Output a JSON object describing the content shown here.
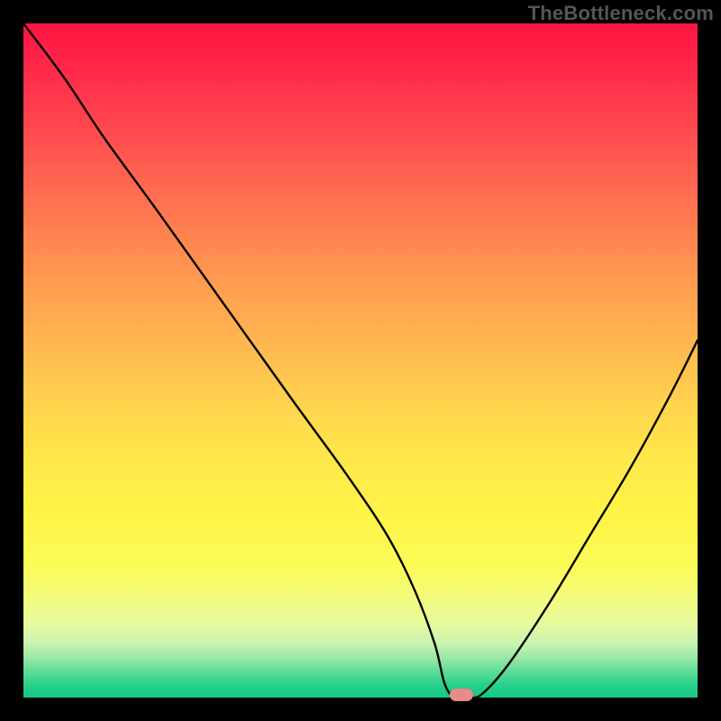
{
  "watermark": "TheBottleneck.com",
  "chart_data": {
    "type": "line",
    "title": "",
    "xlabel": "",
    "ylabel": "",
    "xlim": [
      0,
      100
    ],
    "ylim": [
      0,
      100
    ],
    "grid": false,
    "x": [
      0,
      6,
      12,
      20,
      30,
      40,
      48,
      54,
      58,
      61,
      62.5,
      64,
      66,
      68,
      72,
      78,
      84,
      90,
      96,
      100
    ],
    "values": [
      100,
      92,
      83,
      72,
      58,
      44,
      33,
      24,
      16,
      8,
      2,
      0,
      0,
      0.5,
      5,
      14,
      24,
      34,
      45,
      53
    ],
    "series": [
      {
        "name": "bottleneck-curve",
        "x": [
          0,
          6,
          12,
          20,
          30,
          40,
          48,
          54,
          58,
          61,
          62.5,
          64,
          66,
          68,
          72,
          78,
          84,
          90,
          96,
          100
        ],
        "values": [
          100,
          92,
          83,
          72,
          58,
          44,
          33,
          24,
          16,
          8,
          2,
          0,
          0,
          0.5,
          5,
          14,
          24,
          34,
          45,
          53
        ]
      }
    ],
    "marker": {
      "x": 65,
      "y": 0
    },
    "annotations": []
  },
  "colors": {
    "curve": "#000000",
    "marker": "#e88a8a",
    "frame": "#000000"
  }
}
